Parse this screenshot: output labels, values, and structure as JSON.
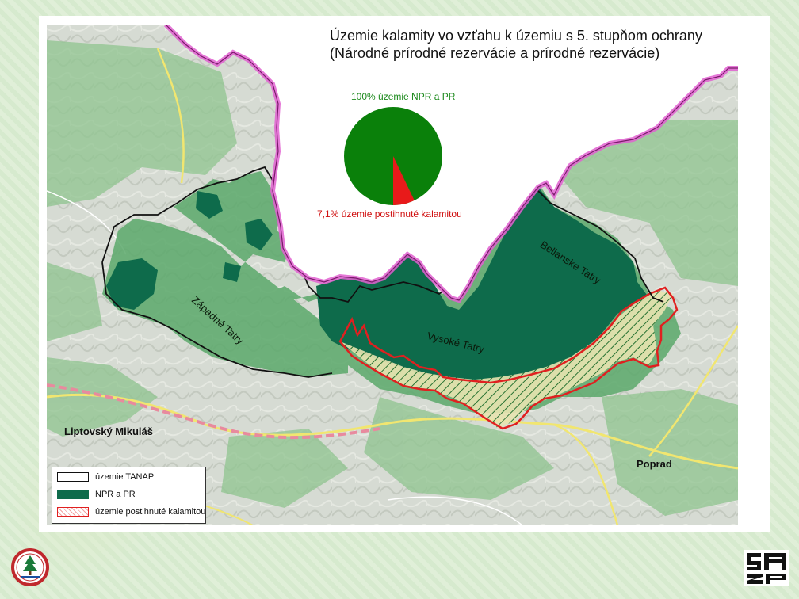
{
  "title": {
    "line1": "Územie kalamity vo vzťahu k územiu s 5. stupňom ochrany",
    "line2": "(Národné prírodné rezervácie a prírodné rezervácie)"
  },
  "pie": {
    "top_label": "100% územie NPR a PR",
    "bottom_label": "7,1% územie postihnuté kalamitou",
    "affected_percent": 7.1,
    "colors": {
      "npr": "#0a800a",
      "affected": "#e81a1a"
    }
  },
  "map_labels": {
    "west": "Západné Tatry",
    "high": "Vysoké Tatry",
    "belianske": "Belianske Tatry",
    "city1": "Liptovský Mikuláš",
    "city2": "Poprad"
  },
  "legend": {
    "items": [
      {
        "label": "územie TANAP"
      },
      {
        "label": "NPR a PR"
      },
      {
        "label": "územie postihnuté kalamitou"
      }
    ]
  },
  "colors": {
    "npr_green": "#0e6b4b",
    "park_green": "#5aa86a",
    "border_pink": "#e060d0",
    "damage_red": "#e02020"
  },
  "logos": {
    "left": "tanap-logo",
    "right": "sazp-logo"
  }
}
